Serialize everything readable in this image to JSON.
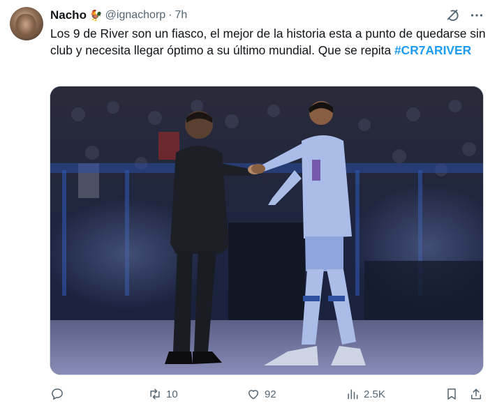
{
  "tweet": {
    "display_name": "Nacho",
    "name_emoji": "🐓",
    "handle": "@ignachorp",
    "separator": "·",
    "time": "7h",
    "text_main": "Los 9 de River son un fiasco, el mejor de la historia esta a punto de quedarse sin club y necesita llegar óptimo a su último mundial. Que se repita ",
    "hashtag": "#CR7ARIVER"
  },
  "actions": {
    "reply": "",
    "retweets": "10",
    "likes": "92",
    "views": "2.5K"
  },
  "icons": {
    "reply": "reply-icon",
    "retweet": "retweet-icon",
    "like": "heart-icon",
    "views": "views-icon",
    "bookmark": "bookmark-icon",
    "share": "share-icon",
    "grok": "grok-icon",
    "more": "more-icon"
  },
  "colors": {
    "accent": "#1d9bf0",
    "muted": "#536471",
    "text": "#0f1419"
  }
}
